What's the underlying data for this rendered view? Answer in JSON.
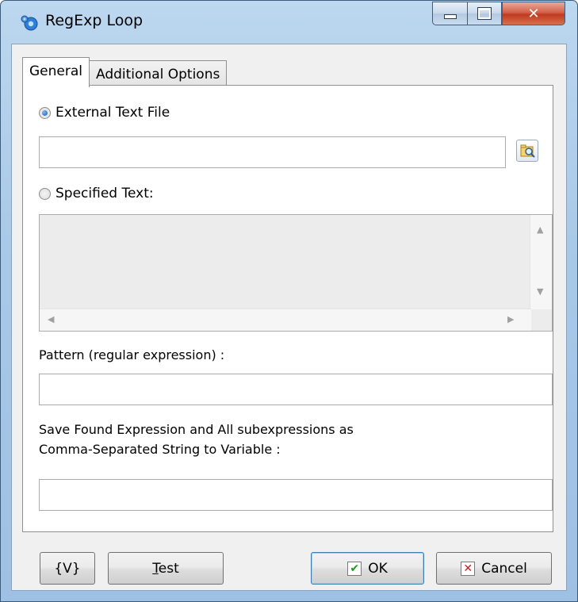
{
  "window": {
    "title": "RegExp Loop",
    "caption_buttons": {
      "minimize": "minimize-icon",
      "maximize": "maximize-icon",
      "close": "close-icon"
    }
  },
  "tabs": [
    {
      "label": "General",
      "active": true
    },
    {
      "label": "Additional Options",
      "active": false
    }
  ],
  "general": {
    "external_radio_label": "External Text File",
    "external_selected": true,
    "external_file_value": "",
    "browse_icon": "browse-folder-icon",
    "specified_radio_label": "Specified Text:",
    "specified_selected": false,
    "specified_text_value": "",
    "pattern_label": "Pattern (regular expression) :",
    "pattern_value": "",
    "save_label_line1": "Save Found Expression and All subexpressions as",
    "save_label_line2": "Comma-Separated String to Variable :",
    "save_value": ""
  },
  "footer": {
    "variables_label": "{V}",
    "test_label_underlined": "T",
    "test_label_rest": "est",
    "ok_label": "OK",
    "cancel_label": "Cancel"
  },
  "colors": {
    "ok_check": "#1d9a1d",
    "cancel_x": "#d21a1a",
    "radio_selected": "#1a59b5"
  }
}
